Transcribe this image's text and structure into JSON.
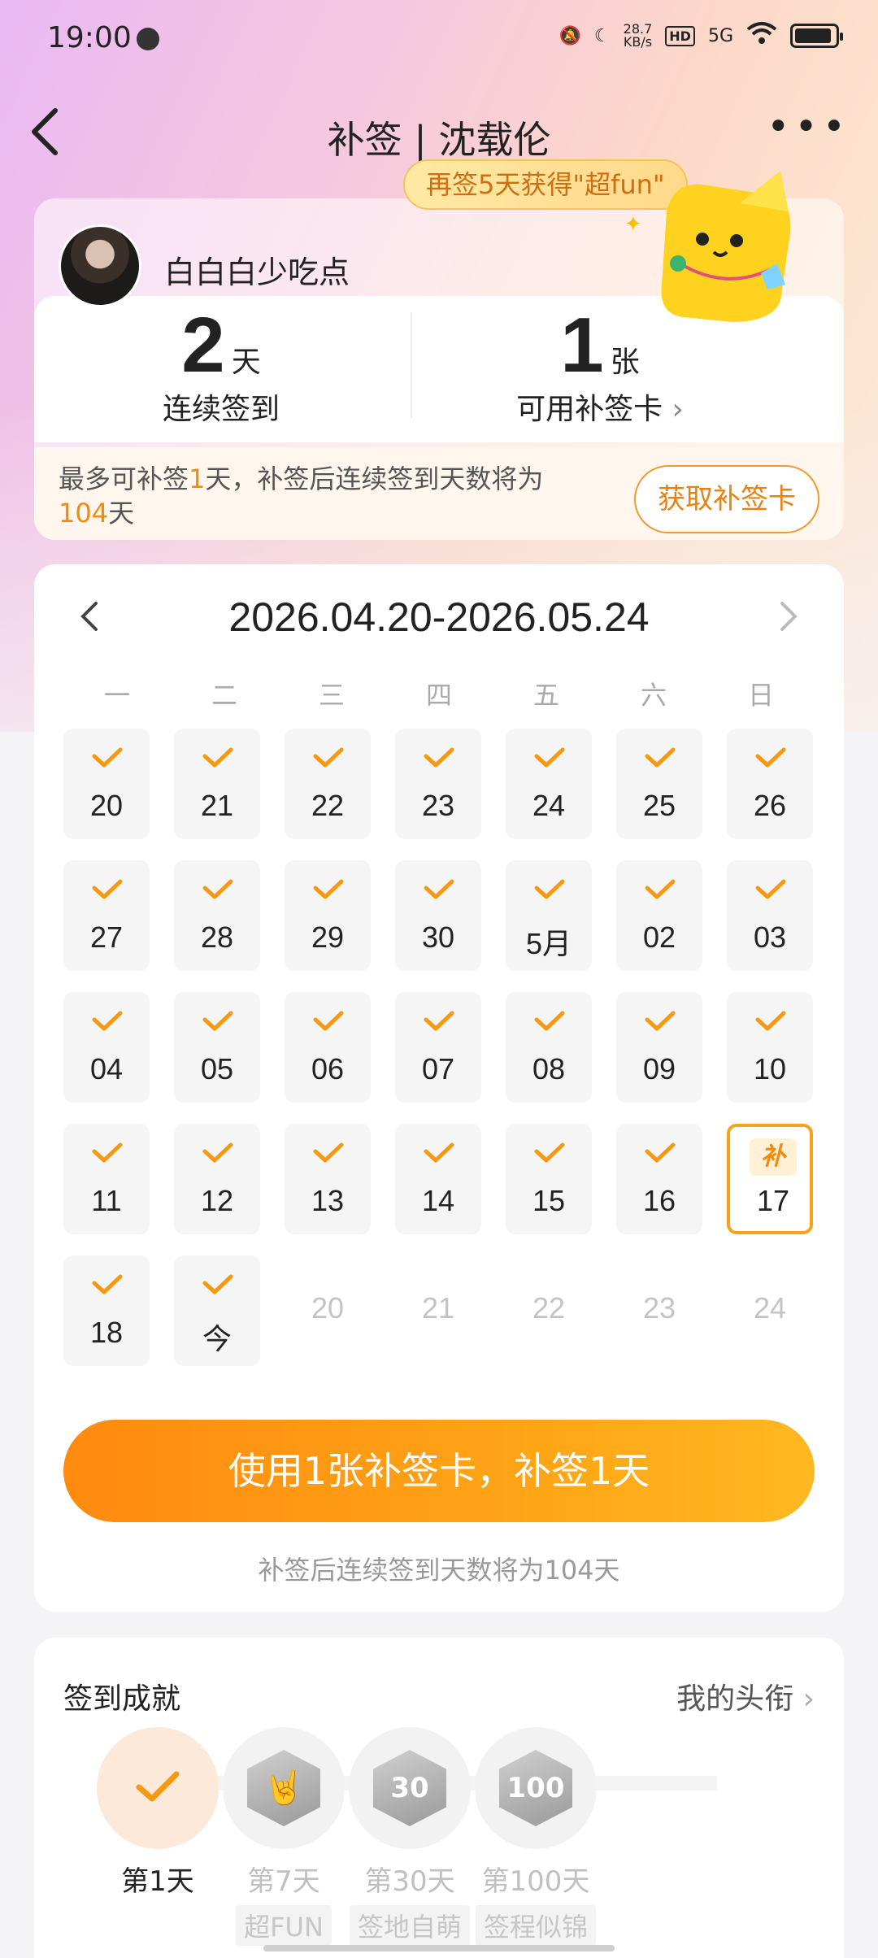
{
  "status_bar": {
    "time": "19:00",
    "speed": "28.7",
    "speed_unit": "KB/s",
    "hd": "HD",
    "network": "5G"
  },
  "header": {
    "title": "补签 | 沈载伦",
    "promo": "再签5天获得\"超fun\""
  },
  "profile": {
    "username": "白白白少吃点",
    "streak": {
      "value": "2",
      "unit": "天",
      "label": "连续签到"
    },
    "cards": {
      "value": "1",
      "unit": "张",
      "label": "可用补签卡"
    },
    "info_prefix": "最多可补签",
    "info_num": "1",
    "info_mid": "天，补签后连续签到天数将为",
    "info_days": "104",
    "info_suffix": "天",
    "get_card_label": "获取补签卡"
  },
  "calendar": {
    "range": "2026.04.20-2026.05.24",
    "weekdays": [
      "一",
      "二",
      "三",
      "四",
      "五",
      "六",
      "日"
    ],
    "days": [
      {
        "label": "20",
        "state": "signed"
      },
      {
        "label": "21",
        "state": "signed"
      },
      {
        "label": "22",
        "state": "signed"
      },
      {
        "label": "23",
        "state": "signed"
      },
      {
        "label": "24",
        "state": "signed"
      },
      {
        "label": "25",
        "state": "signed"
      },
      {
        "label": "26",
        "state": "signed"
      },
      {
        "label": "27",
        "state": "signed"
      },
      {
        "label": "28",
        "state": "signed"
      },
      {
        "label": "29",
        "state": "signed"
      },
      {
        "label": "30",
        "state": "signed"
      },
      {
        "label": "5月",
        "state": "signed"
      },
      {
        "label": "02",
        "state": "signed"
      },
      {
        "label": "03",
        "state": "signed"
      },
      {
        "label": "04",
        "state": "signed"
      },
      {
        "label": "05",
        "state": "signed"
      },
      {
        "label": "06",
        "state": "signed"
      },
      {
        "label": "07",
        "state": "signed"
      },
      {
        "label": "08",
        "state": "signed"
      },
      {
        "label": "09",
        "state": "signed"
      },
      {
        "label": "10",
        "state": "signed"
      },
      {
        "label": "11",
        "state": "signed"
      },
      {
        "label": "12",
        "state": "signed"
      },
      {
        "label": "13",
        "state": "signed"
      },
      {
        "label": "14",
        "state": "signed"
      },
      {
        "label": "15",
        "state": "signed"
      },
      {
        "label": "16",
        "state": "signed"
      },
      {
        "label": "17",
        "state": "makeup"
      },
      {
        "label": "18",
        "state": "signed"
      },
      {
        "label": "今",
        "state": "signed"
      },
      {
        "label": "20",
        "state": "future"
      },
      {
        "label": "21",
        "state": "future"
      },
      {
        "label": "22",
        "state": "future"
      },
      {
        "label": "23",
        "state": "future"
      },
      {
        "label": "24",
        "state": "future"
      }
    ],
    "makeup_badge": "补",
    "use_button": "使用1张补签卡，补签1天",
    "note": "补签后连续签到天数将为104天"
  },
  "achievements": {
    "title": "签到成就",
    "link": "我的头衔",
    "items": [
      {
        "day": "第1天",
        "tag": "",
        "done": true,
        "badge_text": ""
      },
      {
        "day": "第7天",
        "tag": "超FUN",
        "done": false,
        "badge_text": "🤘"
      },
      {
        "day": "第30天",
        "tag": "签地自萌",
        "done": false,
        "badge_text": "30"
      },
      {
        "day": "第100天",
        "tag": "签程似锦",
        "done": false,
        "badge_text": "100"
      }
    ]
  },
  "colors": {
    "accent": "#ff8a10",
    "accent_light": "#fff0d6",
    "text": "#222222"
  }
}
